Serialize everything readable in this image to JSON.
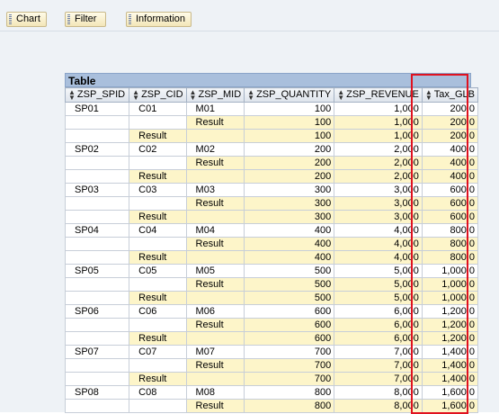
{
  "toolbar": {
    "buttons": [
      {
        "label": "Chart"
      },
      {
        "label": "Filter"
      },
      {
        "label": "Information"
      }
    ]
  },
  "table": {
    "title": "Table",
    "columns": [
      "ZSP_SPID",
      "ZSP_CID",
      "ZSP_MID",
      "ZSP_QUANTITY",
      "ZSP_REVENUE",
      "Tax_GLB"
    ],
    "rows": [
      [
        "SP01",
        "C01",
        "M01",
        "100",
        "1,000",
        "200.0"
      ],
      [
        "",
        "",
        "Result",
        "100",
        "1,000",
        "200.0"
      ],
      [
        "",
        "Result",
        "",
        "100",
        "1,000",
        "200.0"
      ],
      [
        "SP02",
        "C02",
        "M02",
        "200",
        "2,000",
        "400.0"
      ],
      [
        "",
        "",
        "Result",
        "200",
        "2,000",
        "400.0"
      ],
      [
        "",
        "Result",
        "",
        "200",
        "2,000",
        "400.0"
      ],
      [
        "SP03",
        "C03",
        "M03",
        "300",
        "3,000",
        "600.0"
      ],
      [
        "",
        "",
        "Result",
        "300",
        "3,000",
        "600.0"
      ],
      [
        "",
        "Result",
        "",
        "300",
        "3,000",
        "600.0"
      ],
      [
        "SP04",
        "C04",
        "M04",
        "400",
        "4,000",
        "800.0"
      ],
      [
        "",
        "",
        "Result",
        "400",
        "4,000",
        "800.0"
      ],
      [
        "",
        "Result",
        "",
        "400",
        "4,000",
        "800.0"
      ],
      [
        "SP05",
        "C05",
        "M05",
        "500",
        "5,000",
        "1,000.0"
      ],
      [
        "",
        "",
        "Result",
        "500",
        "5,000",
        "1,000.0"
      ],
      [
        "",
        "Result",
        "",
        "500",
        "5,000",
        "1,000.0"
      ],
      [
        "SP06",
        "C06",
        "M06",
        "600",
        "6,000",
        "1,200.0"
      ],
      [
        "",
        "",
        "Result",
        "600",
        "6,000",
        "1,200.0"
      ],
      [
        "",
        "Result",
        "",
        "600",
        "6,000",
        "1,200.0"
      ],
      [
        "SP07",
        "C07",
        "M07",
        "700",
        "7,000",
        "1,400.0"
      ],
      [
        "",
        "",
        "Result",
        "700",
        "7,000",
        "1,400.0"
      ],
      [
        "",
        "Result",
        "",
        "700",
        "7,000",
        "1,400.0"
      ],
      [
        "SP08",
        "C08",
        "M08",
        "800",
        "8,000",
        "1,600.0"
      ],
      [
        "",
        "",
        "Result",
        "800",
        "8,000",
        "1,600.0"
      ]
    ]
  },
  "colors": {
    "highlight": "#e0121f",
    "result_row": "#fdf5c9",
    "header_bar": "#a9bfdc"
  }
}
